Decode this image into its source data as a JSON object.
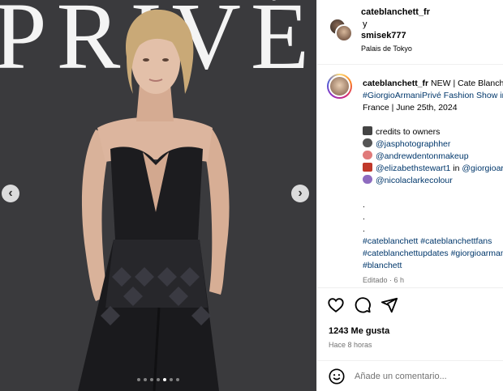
{
  "photo": {
    "backdrop_text": "PRIVÉ",
    "prev_glyph": "‹",
    "next_glyph": "›",
    "carousel_dots": 7,
    "active_dot": 5
  },
  "header": {
    "user1": "cateblanchett_fr",
    "conjunction": "y",
    "user2": "smisek777",
    "location": "Palais de Tokyo"
  },
  "caption": {
    "username": "cateblanchett_fr",
    "lines": {
      "l1": " NEW | Cate Blanchett attends the",
      "l2": "#GiorgioArmaniPrivé Fashion Show in Paris,",
      "l3": "France | June 25th, 2024",
      "credits": "credits to owners",
      "c1": "@jasphotographher",
      "c2": "@andrewdentonmakeup",
      "c3a": "@elizabethstewart1",
      "c3b": " in ",
      "c3c": "@giorgioarmani",
      "c4": "@nicolaclarkecolour",
      "dot": ".",
      "h1a": "#cateblanchett",
      "h1b": "#cateblanchettfans",
      "h2a": "#cateblanchettupdates",
      "h2b": "#giorgioarmani",
      "h3": "#blanchett"
    },
    "edited": "Editado · 6 h"
  },
  "actions": {
    "likes": "1243 Me gusta",
    "time": "Hace 8 horas"
  },
  "comment": {
    "placeholder": "Añade un comentario..."
  },
  "icons": {
    "like": "heart-icon",
    "comment": "comment-bubble-icon",
    "share": "paper-plane-icon",
    "emoji": "smiley-icon"
  },
  "colors": {
    "link": "#00376b",
    "muted": "#737373",
    "photo_bg": "#3a3a3d"
  }
}
